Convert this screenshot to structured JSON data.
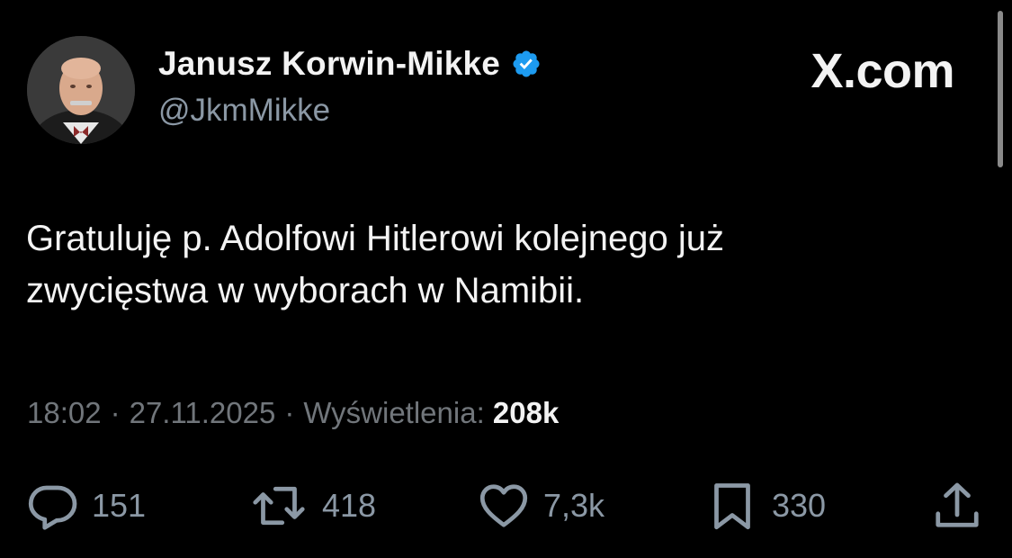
{
  "author": {
    "display_name": "Janusz Korwin-Mikke",
    "handle": "@JkmMikke",
    "verified": true,
    "verified_color": "#1d9bf0"
  },
  "watermark": "X.com",
  "tweet": {
    "lines": [
      "Gratuluję p. Adolfowi Hitlerowi kolejnego już",
      "zwycięstwa w wyborach w Namibii."
    ]
  },
  "meta": {
    "time": "18:02",
    "separator": "·",
    "date": "27.11.2025",
    "views_label": "Wyświetlenia:",
    "views_value": "208k"
  },
  "actions": {
    "reply": {
      "icon": "reply-icon",
      "count": "151"
    },
    "repost": {
      "icon": "repost-icon",
      "count": "418"
    },
    "like": {
      "icon": "heart-icon",
      "count": "7,3k"
    },
    "bookmark": {
      "icon": "bookmark-icon",
      "count": "330"
    },
    "share": {
      "icon": "share-icon"
    }
  },
  "colors": {
    "background": "#000000",
    "primary_text": "#f3f3f3",
    "secondary_text": "#71767b",
    "icon": "#8b98a5"
  }
}
